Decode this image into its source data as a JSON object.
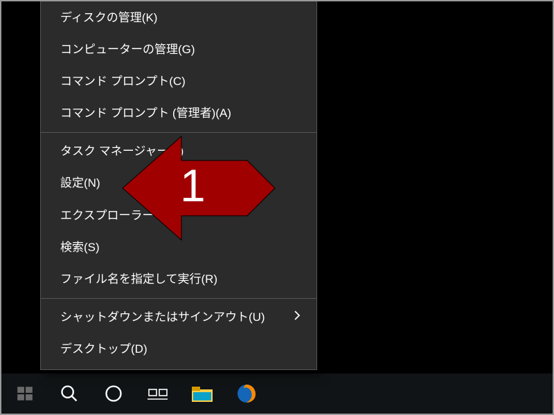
{
  "menu": {
    "groups": [
      {
        "items": [
          {
            "label": "ディスクの管理(K)"
          },
          {
            "label": "コンピューターの管理(G)"
          },
          {
            "label": "コマンド プロンプト(C)"
          },
          {
            "label": "コマンド プロンプト (管理者)(A)"
          }
        ]
      },
      {
        "items": [
          {
            "label": "タスク マネージャー(T)"
          },
          {
            "label": "設定(N)"
          },
          {
            "label": "エクスプローラー"
          },
          {
            "label": "検索(S)"
          },
          {
            "label": "ファイル名を指定して実行(R)"
          }
        ]
      },
      {
        "items": [
          {
            "label": "シャットダウンまたはサインアウト(U)",
            "submenu": true
          },
          {
            "label": "デスクトップ(D)"
          }
        ]
      }
    ]
  },
  "annotation": {
    "label": "1",
    "color": "#a00000",
    "target_item": "設定(N)"
  },
  "taskbar": {
    "items": [
      {
        "name": "start-button",
        "icon": "windows-icon"
      },
      {
        "name": "search-button",
        "icon": "search-icon"
      },
      {
        "name": "cortana-button",
        "icon": "cortana-icon"
      },
      {
        "name": "task-view-button",
        "icon": "task-view-icon"
      },
      {
        "name": "file-explorer-button",
        "icon": "file-explorer-icon"
      },
      {
        "name": "firefox-button",
        "icon": "firefox-icon"
      }
    ]
  }
}
